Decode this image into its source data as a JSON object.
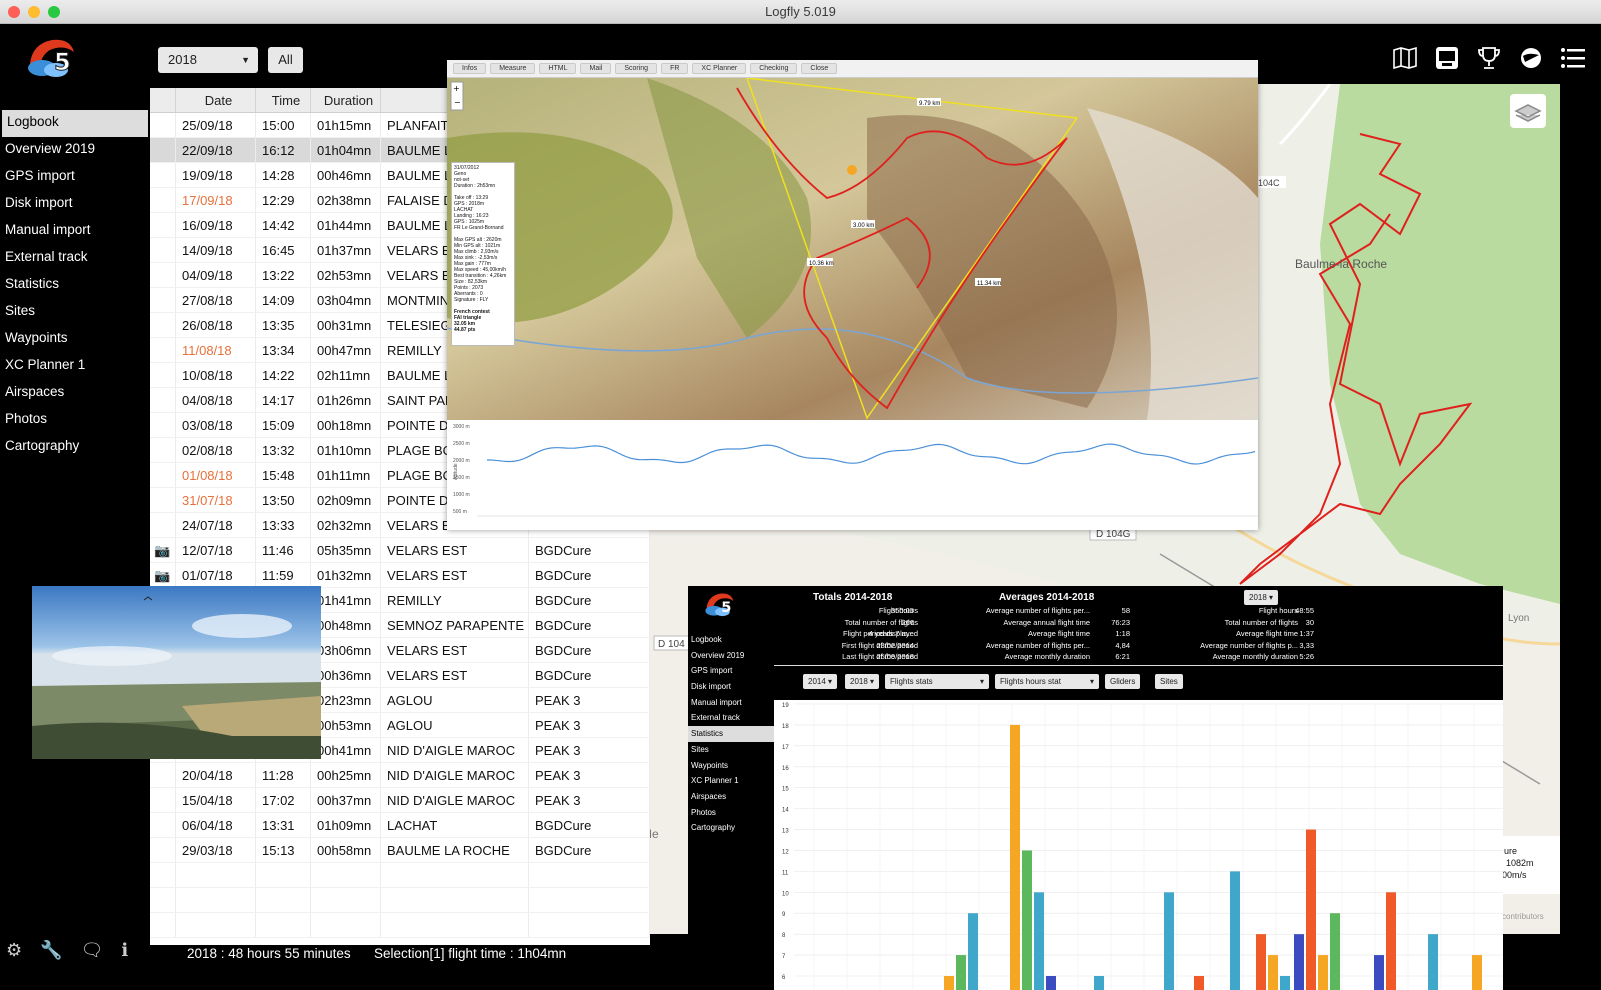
{
  "window": {
    "title": "Logfly 5.019"
  },
  "toolbar": {
    "year": "2018",
    "all_label": "All"
  },
  "top_icons": [
    "map-book-icon",
    "gps-device-icon",
    "trophy-icon",
    "globe-icon",
    "menu-icon"
  ],
  "sidebar": {
    "items": [
      {
        "label": "Logbook"
      },
      {
        "label": "Overview  2019"
      },
      {
        "label": "GPS import"
      },
      {
        "label": "Disk import"
      },
      {
        "label": "Manual import"
      },
      {
        "label": "External track"
      },
      {
        "label": "Statistics"
      },
      {
        "label": "Sites"
      },
      {
        "label": "Waypoints"
      },
      {
        "label": "XC Planner 1"
      },
      {
        "label": "Airspaces"
      },
      {
        "label": "Photos"
      },
      {
        "label": "Cartography"
      }
    ]
  },
  "table": {
    "columns": [
      "",
      "Date",
      "Time",
      "Duration",
      "Si"
    ],
    "rows": [
      {
        "photo": false,
        "date": "25/09/18",
        "time": "15:00",
        "duration": "01h15mn",
        "site": "PLANFAIT",
        "glider": "",
        "orange": false,
        "selected": false
      },
      {
        "photo": false,
        "date": "22/09/18",
        "time": "16:12",
        "duration": "01h04mn",
        "site": "BAULME LA",
        "glider": "",
        "orange": false,
        "selected": true
      },
      {
        "photo": false,
        "date": "19/09/18",
        "time": "14:28",
        "duration": "00h46mn",
        "site": "BAULME LA",
        "glider": "",
        "orange": false,
        "selected": false
      },
      {
        "photo": false,
        "date": "17/09/18",
        "time": "12:29",
        "duration": "02h38mn",
        "site": "FALAISE DE",
        "glider": "",
        "orange": true,
        "selected": false
      },
      {
        "photo": false,
        "date": "16/09/18",
        "time": "14:42",
        "duration": "01h44mn",
        "site": "BAULME LA",
        "glider": "",
        "orange": false,
        "selected": false
      },
      {
        "photo": false,
        "date": "14/09/18",
        "time": "16:45",
        "duration": "01h37mn",
        "site": "VELARS ES",
        "glider": "",
        "orange": false,
        "selected": false
      },
      {
        "photo": false,
        "date": "04/09/18",
        "time": "13:22",
        "duration": "02h53mn",
        "site": "VELARS ES",
        "glider": "",
        "orange": false,
        "selected": false
      },
      {
        "photo": false,
        "date": "27/08/18",
        "time": "14:09",
        "duration": "03h04mn",
        "site": "MONTMIN",
        "glider": "",
        "orange": false,
        "selected": false
      },
      {
        "photo": false,
        "date": "26/08/18",
        "time": "13:35",
        "duration": "00h31mn",
        "site": "TELESIEGE",
        "glider": "",
        "orange": false,
        "selected": false
      },
      {
        "photo": false,
        "date": "11/08/18",
        "time": "13:34",
        "duration": "00h47mn",
        "site": "REMILLY",
        "glider": "",
        "orange": true,
        "selected": false
      },
      {
        "photo": false,
        "date": "10/08/18",
        "time": "14:22",
        "duration": "02h11mn",
        "site": "BAULME LA",
        "glider": "",
        "orange": false,
        "selected": false
      },
      {
        "photo": false,
        "date": "04/08/18",
        "time": "14:17",
        "duration": "01h26mn",
        "site": "SAINT PABU",
        "glider": "",
        "orange": false,
        "selected": false
      },
      {
        "photo": false,
        "date": "03/08/18",
        "time": "15:09",
        "duration": "00h18mn",
        "site": "POINTE DE",
        "glider": "",
        "orange": false,
        "selected": false
      },
      {
        "photo": false,
        "date": "02/08/18",
        "time": "13:32",
        "duration": "01h10mn",
        "site": "PLAGE BON",
        "glider": "",
        "orange": false,
        "selected": false
      },
      {
        "photo": false,
        "date": "01/08/18",
        "time": "15:48",
        "duration": "01h11mn",
        "site": "PLAGE BON",
        "glider": "",
        "orange": true,
        "selected": false
      },
      {
        "photo": false,
        "date": "31/07/18",
        "time": "13:50",
        "duration": "02h09mn",
        "site": "POINTE DE",
        "glider": "",
        "orange": true,
        "selected": false
      },
      {
        "photo": false,
        "date": "24/07/18",
        "time": "13:33",
        "duration": "02h32mn",
        "site": "VELARS ES",
        "glider": "",
        "orange": false,
        "selected": false
      },
      {
        "photo": true,
        "date": "12/07/18",
        "time": "11:46",
        "duration": "05h35mn",
        "site": "VELARS EST",
        "glider": "BGDCure",
        "orange": false,
        "selected": false
      },
      {
        "photo": true,
        "date": "01/07/18",
        "time": "11:59",
        "duration": "01h32mn",
        "site": "VELARS EST",
        "glider": "BGDCure",
        "orange": false,
        "selected": false
      },
      {
        "photo": false,
        "date": "",
        "time": "",
        "duration": "01h41mn",
        "site": "REMILLY",
        "glider": "BGDCure",
        "orange": false,
        "selected": false
      },
      {
        "photo": false,
        "date": "",
        "time": "",
        "duration": "00h48mn",
        "site": "SEMNOZ PARAPENTE",
        "glider": "BGDCure",
        "orange": false,
        "selected": false
      },
      {
        "photo": false,
        "date": "",
        "time": "",
        "duration": "03h06mn",
        "site": "VELARS EST",
        "glider": "BGDCure",
        "orange": false,
        "selected": false
      },
      {
        "photo": false,
        "date": "",
        "time": "",
        "duration": "00h36mn",
        "site": "VELARS EST",
        "glider": "BGDCure",
        "orange": false,
        "selected": false
      },
      {
        "photo": false,
        "date": "",
        "time": "",
        "duration": "02h23mn",
        "site": "AGLOU",
        "glider": "PEAK 3",
        "orange": false,
        "selected": false
      },
      {
        "photo": false,
        "date": "",
        "time": "",
        "duration": "00h53mn",
        "site": "AGLOU",
        "glider": "PEAK 3",
        "orange": false,
        "selected": false
      },
      {
        "photo": false,
        "date": "",
        "time": "",
        "duration": "00h41mn",
        "site": "NID D'AIGLE MAROC",
        "glider": "PEAK 3",
        "orange": false,
        "selected": false
      },
      {
        "photo": false,
        "date": "20/04/18",
        "time": "11:28",
        "duration": "00h25mn",
        "site": "NID D'AIGLE MAROC",
        "glider": "PEAK 3",
        "orange": false,
        "selected": false
      },
      {
        "photo": false,
        "date": "15/04/18",
        "time": "17:02",
        "duration": "00h37mn",
        "site": "NID D'AIGLE MAROC",
        "glider": "PEAK 3",
        "orange": false,
        "selected": false
      },
      {
        "photo": false,
        "date": "06/04/18",
        "time": "13:31",
        "duration": "01h09mn",
        "site": "LACHAT",
        "glider": "BGDCure",
        "orange": false,
        "selected": false
      },
      {
        "photo": false,
        "date": "29/03/18",
        "time": "15:13",
        "duration": "00h58mn",
        "site": "BAULME LA ROCHE",
        "glider": "BGDCure",
        "orange": false,
        "selected": false
      }
    ]
  },
  "topo": {
    "buttons": [
      "Infos",
      "Measure",
      "HTML",
      "Mail",
      "Scoring",
      "FR",
      "XC Planner",
      "Checking",
      "Close"
    ],
    "info_lines": [
      "31/07/2012",
      "Geno",
      "not-set",
      "Duration : 2h53mn",
      "",
      "Take off : 13:29",
      "GPS : 2018m",
      "LACHAT",
      "Landing : 16:23",
      "GPS : 1025m",
      "FR Le Grand-Bornand",
      "",
      "Max GPS alt : 2620m",
      "Min GPS alt : 1021m",
      "Max climb : 2,93m/s",
      "Max sink : -2,53m/s",
      "Max gain : 777m",
      "Max speed : 45,00km/h",
      "Best transition : 4,26km",
      "Size : 82,53km",
      "Points : 2073",
      "Aberrants : 0",
      "Signature : FLY",
      "",
      "French contest",
      "FAI triangle",
      "32.05 km",
      "44.87 pts"
    ],
    "legs": [
      "9.79 km",
      "3.00 km",
      "10.36 km",
      "11.34 km"
    ],
    "profile_ticks": [
      "3000 m",
      "2500 m",
      "2000 m",
      "1500 m",
      "1000 m",
      "500 m"
    ],
    "profile_axis": "Altitude"
  },
  "bgmap": {
    "labels": [
      "Baulme-la Roche",
      "104C",
      "D 104G",
      "D 104",
      "Lyon",
      "Me"
    ],
    "info": [
      "ure",
      "1082m",
      "00m/s"
    ],
    "footer": "contributors"
  },
  "stats": {
    "sidebar": [
      "Logbook",
      "Overview  2019",
      "GPS import",
      "Disk import",
      "Manual import",
      "External track",
      "Statistics",
      "Sites",
      "Waypoints",
      "XC Planner 1",
      "Airspaces",
      "Photos",
      "Cartography"
    ],
    "totals_title": "Totals 2014-2018",
    "totals": [
      [
        "Flight hours",
        "350:05"
      ],
      [
        "Total number of flights",
        "266"
      ],
      [
        "Flight period displayed",
        "4 years 7 m..."
      ],
      [
        "First flight of the period",
        "23/02/2014"
      ],
      [
        "Last flight of the period",
        "25/09/2018"
      ]
    ],
    "averages_title": "Averages 2014-2018",
    "averages": [
      [
        "Average number of flights per...",
        "58"
      ],
      [
        "Average annual flight time",
        "76:23"
      ],
      [
        "Average flight time",
        "1:18"
      ],
      [
        "Average number of flights per...",
        "4,84"
      ],
      [
        "Average monthly duration",
        "6:21"
      ]
    ],
    "year_select": "2018",
    "year_stats": [
      [
        "Flight hours",
        "48:55"
      ],
      [
        "Total number of flights",
        "30"
      ],
      [
        "Average flight time",
        "1:37"
      ],
      [
        "Average number of flights p...",
        "3,33"
      ],
      [
        "Average monthly duration",
        "5:26"
      ]
    ],
    "controls": {
      "from": "2014",
      "to": "2018",
      "left_stat": "Flights stats",
      "right_stat": "Flights hours stat",
      "gliders": "Gliders",
      "sites": "Sites"
    }
  },
  "chart_data": {
    "type": "bar",
    "yticks": [
      "19",
      "18",
      "17",
      "16",
      "15",
      "14",
      "13",
      "12",
      "11",
      "10",
      "9",
      "8",
      "7",
      "6"
    ],
    "ylim": [
      6,
      19
    ],
    "bars": [
      {
        "group": 1,
        "color": "#f5a623",
        "value": 6.0
      },
      {
        "group": 1,
        "color": "#5cb85c",
        "value": 7.0
      },
      {
        "group": 1,
        "color": "#3fa7c9",
        "value": 9.0
      },
      {
        "group": 2,
        "color": "#f5a623",
        "value": 18.0
      },
      {
        "group": 2,
        "color": "#5cb85c",
        "value": 12.0
      },
      {
        "group": 2,
        "color": "#3fa7c9",
        "value": 10.0
      },
      {
        "group": 2,
        "color": "#3b4cc0",
        "value": 6.0
      },
      {
        "group": 3,
        "color": "#3fa7c9",
        "value": 6.0
      },
      {
        "group": 4,
        "color": "#3fa7c9",
        "value": 10.0
      },
      {
        "group": 5,
        "color": "#f05a28",
        "value": 6.0
      },
      {
        "group": 6,
        "color": "#3fa7c9",
        "value": 11.0
      },
      {
        "group": 7,
        "color": "#f05a28",
        "value": 8.0
      },
      {
        "group": 7,
        "color": "#f5a623",
        "value": 7.0
      },
      {
        "group": 7,
        "color": "#3fa7c9",
        "value": 6.0
      },
      {
        "group": 8,
        "color": "#3b4cc0",
        "value": 8.0
      },
      {
        "group": 8,
        "color": "#f05a28",
        "value": 13.0
      },
      {
        "group": 8,
        "color": "#f5a623",
        "value": 7.0
      },
      {
        "group": 8,
        "color": "#5cb85c",
        "value": 9.0
      },
      {
        "group": 9,
        "color": "#3b4cc0",
        "value": 7.0
      },
      {
        "group": 9,
        "color": "#f05a28",
        "value": 10.0
      },
      {
        "group": 10,
        "color": "#3fa7c9",
        "value": 8.0
      },
      {
        "group": 11,
        "color": "#f5a623",
        "value": 7.0
      }
    ]
  },
  "statusbar": {
    "total": "2018 : 48 hours 55 minutes",
    "selection": "Selection[1] flight time : 1h04mn"
  },
  "bottom_icons": [
    "settings-icon",
    "tools-icon",
    "chat-icon",
    "info-icon"
  ]
}
